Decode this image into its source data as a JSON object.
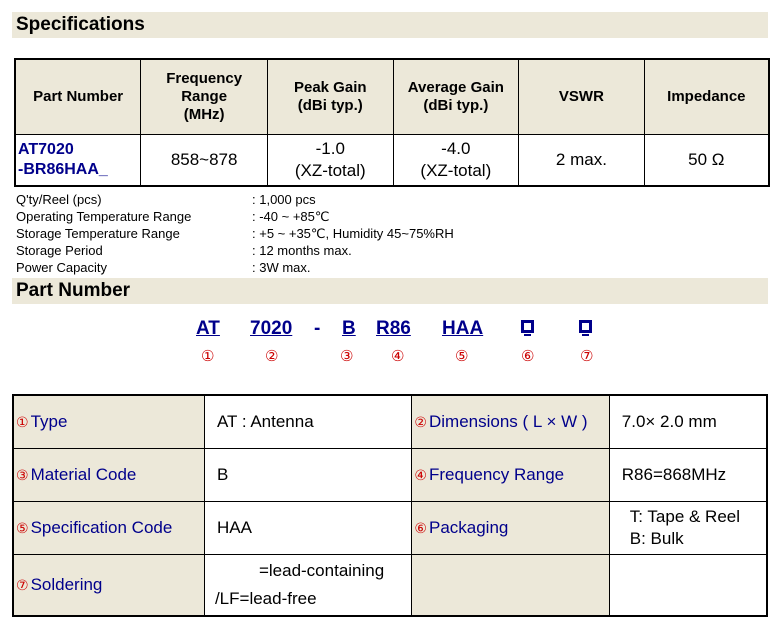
{
  "specifications": {
    "title": "Specifications",
    "headers": [
      "Part Number",
      "Frequency Range (MHz)",
      "Peak Gain (dBi typ.)",
      "Average Gain (dBi typ.)",
      "VSWR",
      "Impedance"
    ],
    "header_lines": {
      "freq": [
        "Frequency",
        "Range",
        "(MHz)"
      ],
      "peak": [
        "Peak Gain",
        "(dBi typ.)"
      ],
      "avg": [
        "Average Gain",
        "(dBi typ.)"
      ]
    },
    "row": {
      "part_number_line1": "AT7020",
      "part_number_line2": "-BR86HAA_",
      "frequency": "858~878",
      "peak_gain_value": "-1.0",
      "peak_gain_note": "(XZ-total)",
      "avg_gain_value": "-4.0",
      "avg_gain_note": "(XZ-total)",
      "vswr": "2 max.",
      "impedance": "50 Ω"
    }
  },
  "properties": [
    {
      "key": "Q'ty/Reel (pcs)",
      "value": ": 1,000 pcs"
    },
    {
      "key": "Operating Temperature Range",
      "value": ": -40 ~ +85℃"
    },
    {
      "key": "Storage Temperature Range",
      "value": ": +5 ~ +35℃, Humidity 45~75%RH"
    },
    {
      "key": "Storage Period",
      "value": ": 12 months max."
    },
    {
      "key": "Power Capacity",
      "value": ": 3W max."
    }
  ],
  "part_number": {
    "title": "Part Number",
    "codes": [
      "AT",
      "7020",
      "-",
      "B",
      "R86",
      "HAA"
    ],
    "markers": [
      "①",
      "②",
      "③",
      "④",
      "⑤",
      "⑥",
      "⑦"
    ]
  },
  "code_table": {
    "rows": [
      {
        "n1": "①",
        "l1": "Type",
        "v1": "AT : Antenna",
        "n2": "②",
        "l2": "Dimensions ( L × W )",
        "v2": "7.0× 2.0 mm"
      },
      {
        "n1": "③",
        "l1": "Material Code",
        "v1": "B",
        "n2": "④",
        "l2": "Frequency Range",
        "v2": "R86=868MHz"
      },
      {
        "n1": "⑤",
        "l1": "Specification Code",
        "v1": "HAA",
        "n2": "⑥",
        "l2": "Packaging",
        "v2a": "T: Tape & Reel",
        "v2b": "B: Bulk"
      },
      {
        "n1": "⑦",
        "l1": "Soldering",
        "v1a": "=lead-containing",
        "v1b": "/LF=lead-free"
      }
    ]
  }
}
